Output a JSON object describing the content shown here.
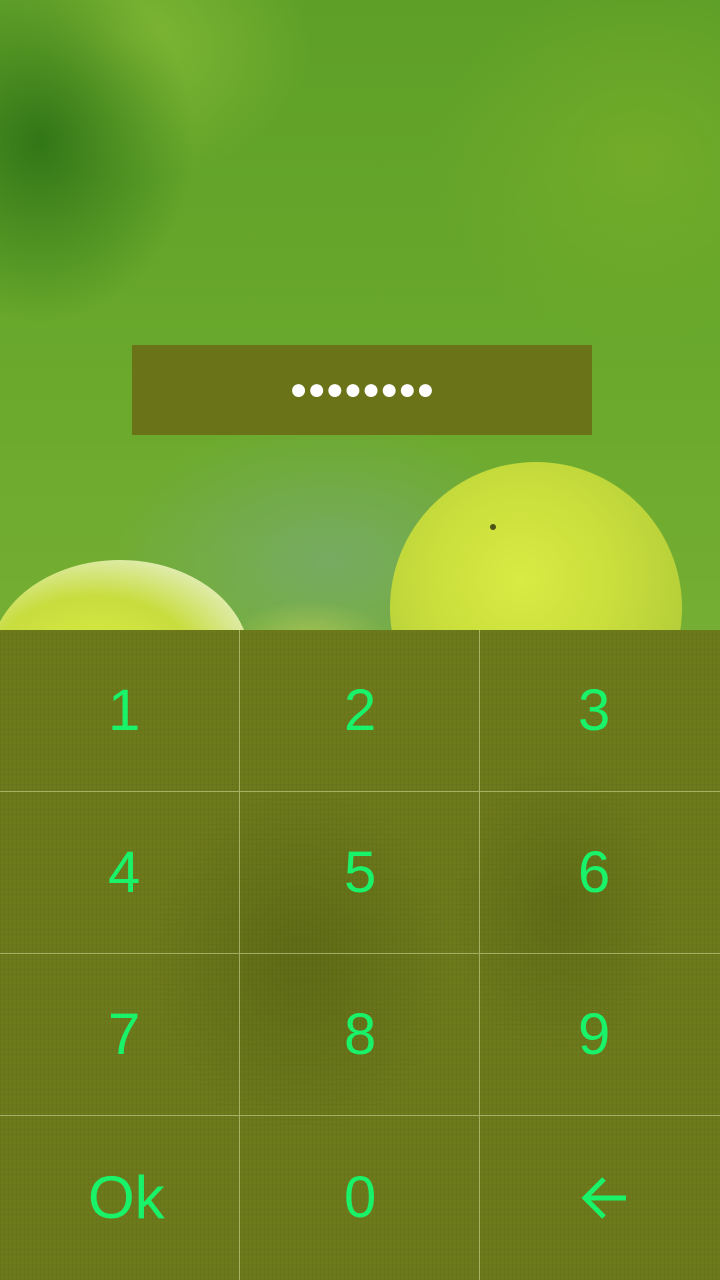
{
  "pin_entry": {
    "masked_value": "●●●●●●●●",
    "digit_count": 8
  },
  "keypad": {
    "keys": [
      {
        "label": "1"
      },
      {
        "label": "2"
      },
      {
        "label": "3"
      },
      {
        "label": "4"
      },
      {
        "label": "5"
      },
      {
        "label": "6"
      },
      {
        "label": "7"
      },
      {
        "label": "8"
      },
      {
        "label": "9"
      },
      {
        "label": "Ok"
      },
      {
        "label": "0"
      },
      {
        "icon": "backspace-arrow-icon"
      }
    ]
  },
  "colors": {
    "key_text": "#19f36a",
    "keypad_background": "#6d7a1c",
    "pin_box_background": "#6b7318",
    "pin_dots": "#ffffff"
  }
}
